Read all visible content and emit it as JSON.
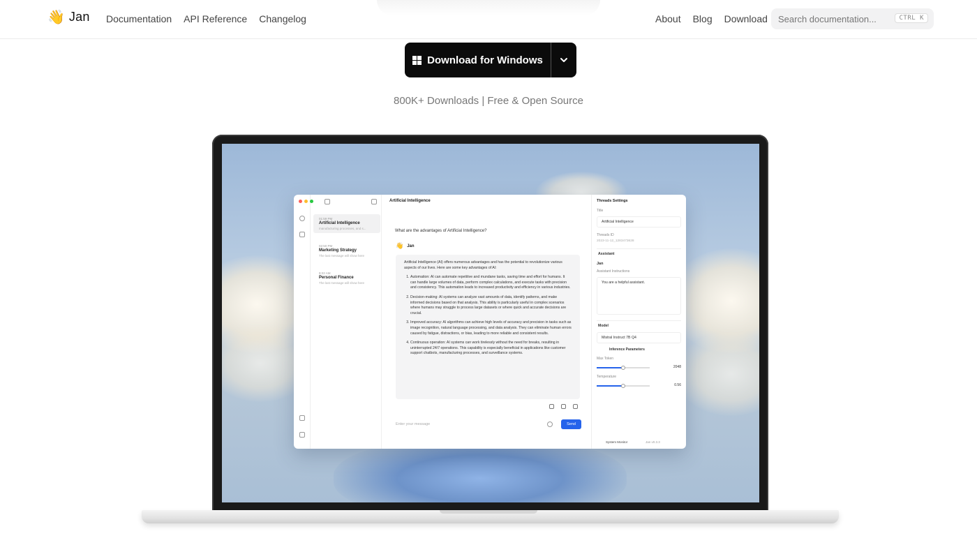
{
  "nav": {
    "brand": "Jan",
    "brand_emoji": "👋",
    "left_links": [
      "Documentation",
      "API Reference",
      "Changelog"
    ],
    "right_links": [
      "About",
      "Blog",
      "Download"
    ],
    "search_placeholder": "Search documentation...",
    "search_shortcut": "CTRL K"
  },
  "hero": {
    "download_label": "Download for Windows",
    "tagline": "800K+ Downloads | Free & Open Source"
  },
  "app": {
    "threads": [
      {
        "time": "01:59 PM",
        "title": "Artificial Intelligence",
        "preview": "manufacturing processes, and s..."
      },
      {
        "time": "02:50 PM",
        "title": "Marketing Strategy",
        "preview": "The last message will show here"
      },
      {
        "time": "9:22 AM",
        "title": "Personal Finance",
        "preview": "The last message will show here"
      }
    ],
    "chat_title": "Artificial Intelligence",
    "question": "What are the advantages of Artificial Intelligence?",
    "assistant_name": "Jan",
    "answer_intro": "Artificial Intelligence (AI) offers numerous advantages and has the potential to revolutionize various aspects of our lives. Here are some key advantages of AI:",
    "answer_points": [
      "Automation: AI can automate repetitive and mundane tasks, saving time and effort for humans. It can handle large volumes of data, perform complex calculations, and execute tasks with precision and consistency. This automation leads to increased productivity and efficiency in various industries.",
      "Decision-making: AI systems can analyze vast amounts of data, identify patterns, and make informed decisions based on that analysis. This ability is particularly useful in complex scenarios where humans may struggle to process large datasets or where quick and accurate decisions are crucial.",
      "Improved accuracy: AI algorithms can achieve high levels of accuracy and precision in tasks such as image recognition, natural language processing, and data analysis. They can eliminate human errors caused by fatigue, distractions, or bias, leading to more reliable and consistent results.",
      "Continuous operation: AI systems can work tirelessly without the need for breaks, resulting in uninterrupted 24/7 operations. This capability is especially beneficial in applications like customer support chatbots, manufacturing processes, and surveillance systems."
    ],
    "composer_placeholder": "Enter your message",
    "send_label": "Send",
    "settings": {
      "header": "Threads Settings",
      "title_label": "Title",
      "title_value": "Artificial Intelligence",
      "thread_id_label": "Threads ID",
      "thread_id_value": "2023-11-12_1283473628",
      "assistant_section": "Assistant",
      "assistant_name": "Jan",
      "instructions_label": "Assistant Instructions",
      "instructions_value": "You are a helpful assistant.",
      "model_section": "Model",
      "model_value": "Mistral Instruct 7B Q4",
      "inference_label": "Inference Parameters",
      "max_token_label": "Max Token",
      "max_token_value": "2048",
      "max_token_level": 0.5,
      "temperature_label": "Temperature",
      "temperature_value": "0.56",
      "temperature_level": 0.5,
      "system_monitor": "System Monitor",
      "version": "Jan v0.3.3"
    }
  }
}
